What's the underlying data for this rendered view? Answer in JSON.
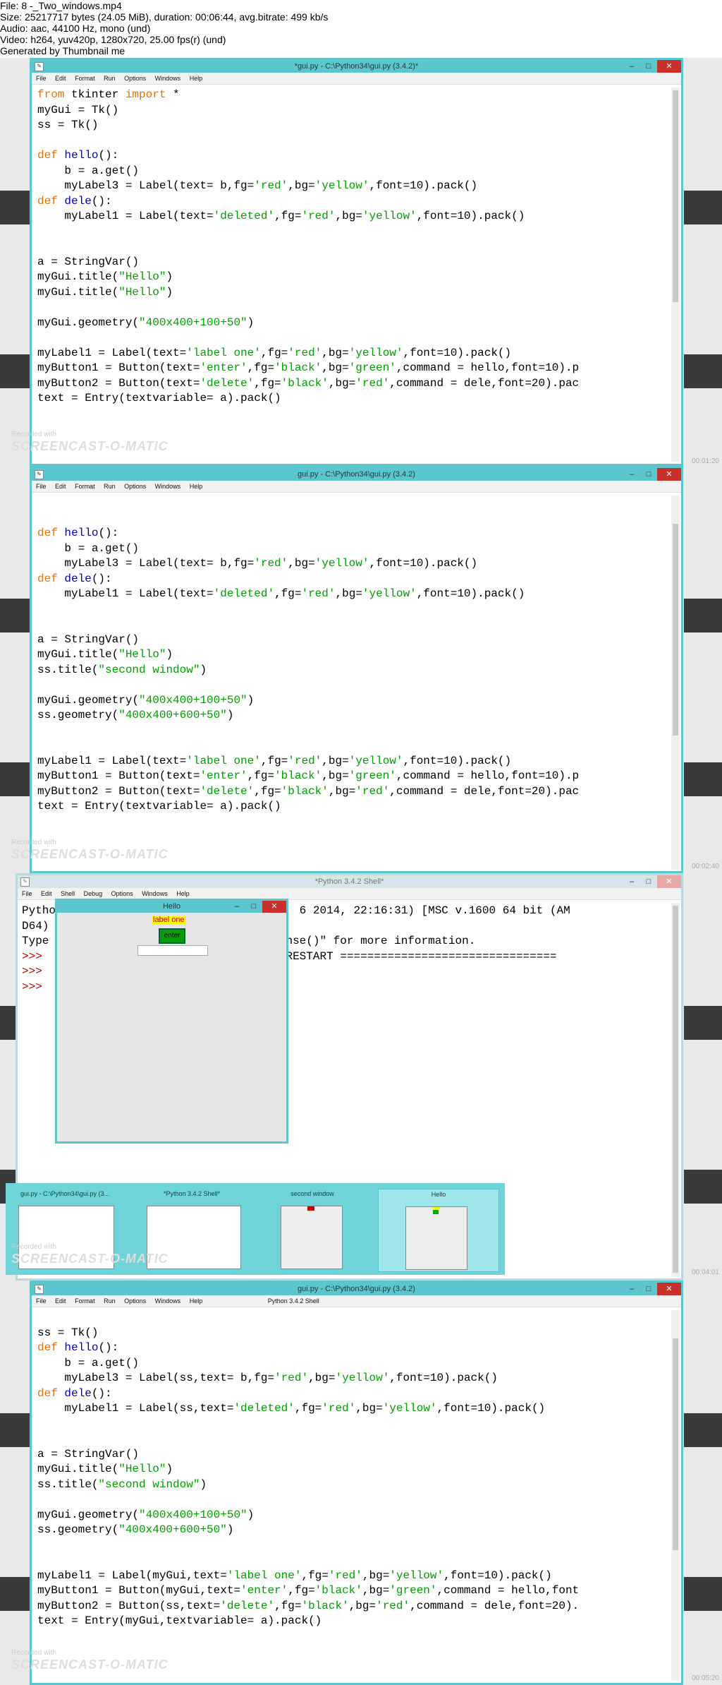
{
  "info": {
    "file": "File: 8 -_Two_windows.mp4",
    "size": "Size: 25217717 bytes (24.05 MiB), duration: 00:06:44, avg.bitrate: 499 kb/s",
    "audio": "Audio: aac, 44100 Hz, mono (und)",
    "video": "Video: h264, yuv420p, 1280x720, 25.00 fps(r) (und)",
    "generated": "Generated by Thumbnail me"
  },
  "menu": [
    "File",
    "Edit",
    "Format",
    "Run",
    "Options",
    "Windows",
    "Help"
  ],
  "shell_menu": [
    "File",
    "Edit",
    "Shell",
    "Debug",
    "Options",
    "Windows",
    "Help"
  ],
  "watermark": {
    "recorded": "Recorded with",
    "brand": "SCREENCAST-O-MATIC"
  },
  "frame1": {
    "title": "*gui.py - C:\\Python34\\gui.py (3.4.2)*",
    "timestamp": "00:01:20"
  },
  "frame2": {
    "title": "gui.py - C:\\Python34\\gui.py (3.4.2)",
    "timestamp": "00:02:40"
  },
  "frame3": {
    "title": "*Python 3.4.2 Shell*",
    "timestamp": "00:04:01",
    "hello_title": "Hello",
    "label_one": "label one",
    "enter": "enter",
    "tabs": [
      {
        "title": "gui.py - C:\\Python34\\gui.py (3..."
      },
      {
        "title": "*Python 3.4.2 Shell*"
      },
      {
        "title": "second window"
      },
      {
        "title": "Hello"
      }
    ]
  },
  "frame4": {
    "title": "gui.py - C:\\Python34\\gui.py (3.4.2)",
    "ghost_title": "Python 3.4.2 Shell",
    "timestamp": "00:05:20"
  },
  "colors": {
    "accent": "#5cc6cf",
    "close": "#c7302b",
    "keyword": "#e8720c",
    "string": "#00a000",
    "def": "#0000d0"
  }
}
